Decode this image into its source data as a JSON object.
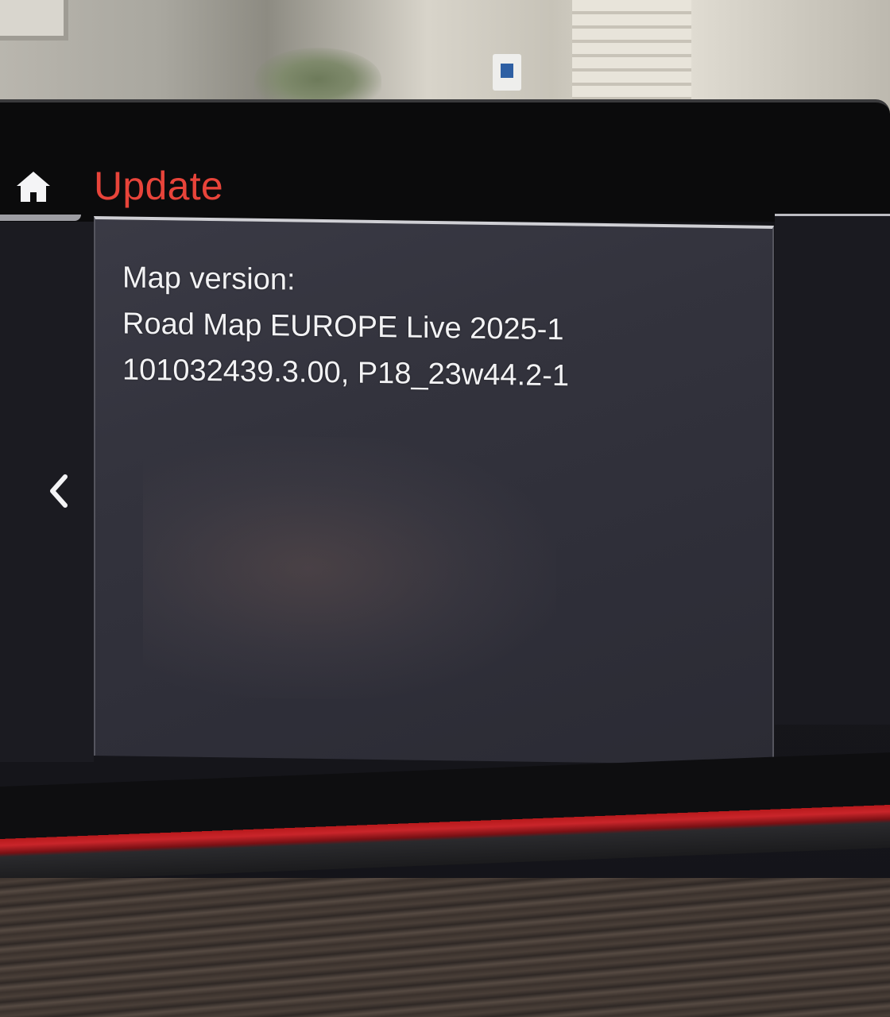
{
  "header": {
    "title": "Update",
    "home_icon": "home-icon"
  },
  "navigation": {
    "back_icon": "chevron-left-icon"
  },
  "content": {
    "label": "Map version:",
    "map_name": "Road Map EUROPE Live 2025-1",
    "version_code": "101032439.3.00, P18_23w44.2-1"
  },
  "colors": {
    "title_accent": "#e8443a",
    "panel_background": "#33333d",
    "text": "#f2f2f4",
    "trim_red": "#c9252a"
  }
}
